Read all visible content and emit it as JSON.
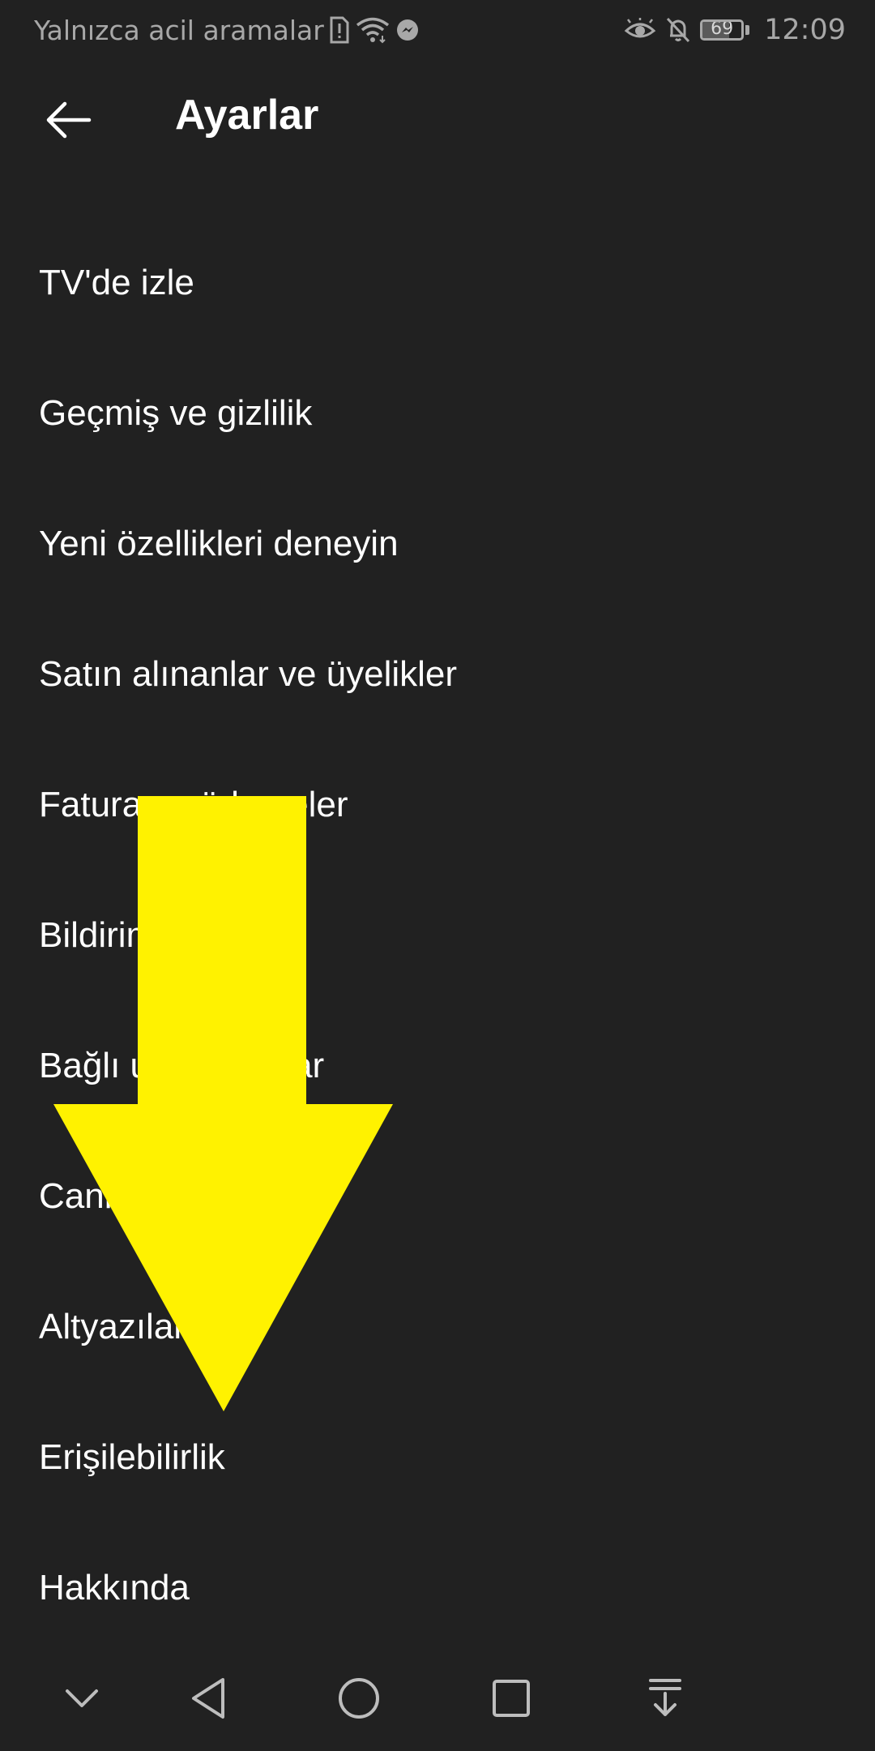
{
  "status_bar": {
    "carrier_text": "Yalnızca acil aramalar",
    "battery_level": "69",
    "battery_fraction": 0.69,
    "time": "12:09",
    "icons": [
      "sim-alert-icon",
      "wifi-icon",
      "messenger-icon",
      "eye-icon",
      "notifications-off-icon",
      "battery-icon"
    ]
  },
  "app_bar": {
    "title": "Ayarlar",
    "back_icon": "arrow-left-icon"
  },
  "settings": {
    "items": [
      {
        "label": "TV'de izle"
      },
      {
        "label": "Geçmiş ve gizlilik"
      },
      {
        "label": "Yeni özellikleri deneyin"
      },
      {
        "label": "Satın alınanlar ve üyelikler"
      },
      {
        "label": "Fatura ve ödemeler"
      },
      {
        "label": "Bildirimler"
      },
      {
        "label": "Bağlı uygulamalar"
      },
      {
        "label": "Canlı sohbet"
      },
      {
        "label": "Altyazılar"
      },
      {
        "label": "Erişilebilirlik"
      },
      {
        "label": "Hakkında"
      }
    ]
  },
  "annotation": {
    "type": "arrow-down",
    "color": "#fff200"
  },
  "nav_bar": {
    "buttons": [
      "chevron-down-icon",
      "back-triangle-icon",
      "home-circle-icon",
      "recents-square-icon",
      "notification-pull-icon"
    ]
  },
  "colors": {
    "background": "#212121",
    "text": "#ffffff",
    "status_text": "#a8a8a8"
  }
}
